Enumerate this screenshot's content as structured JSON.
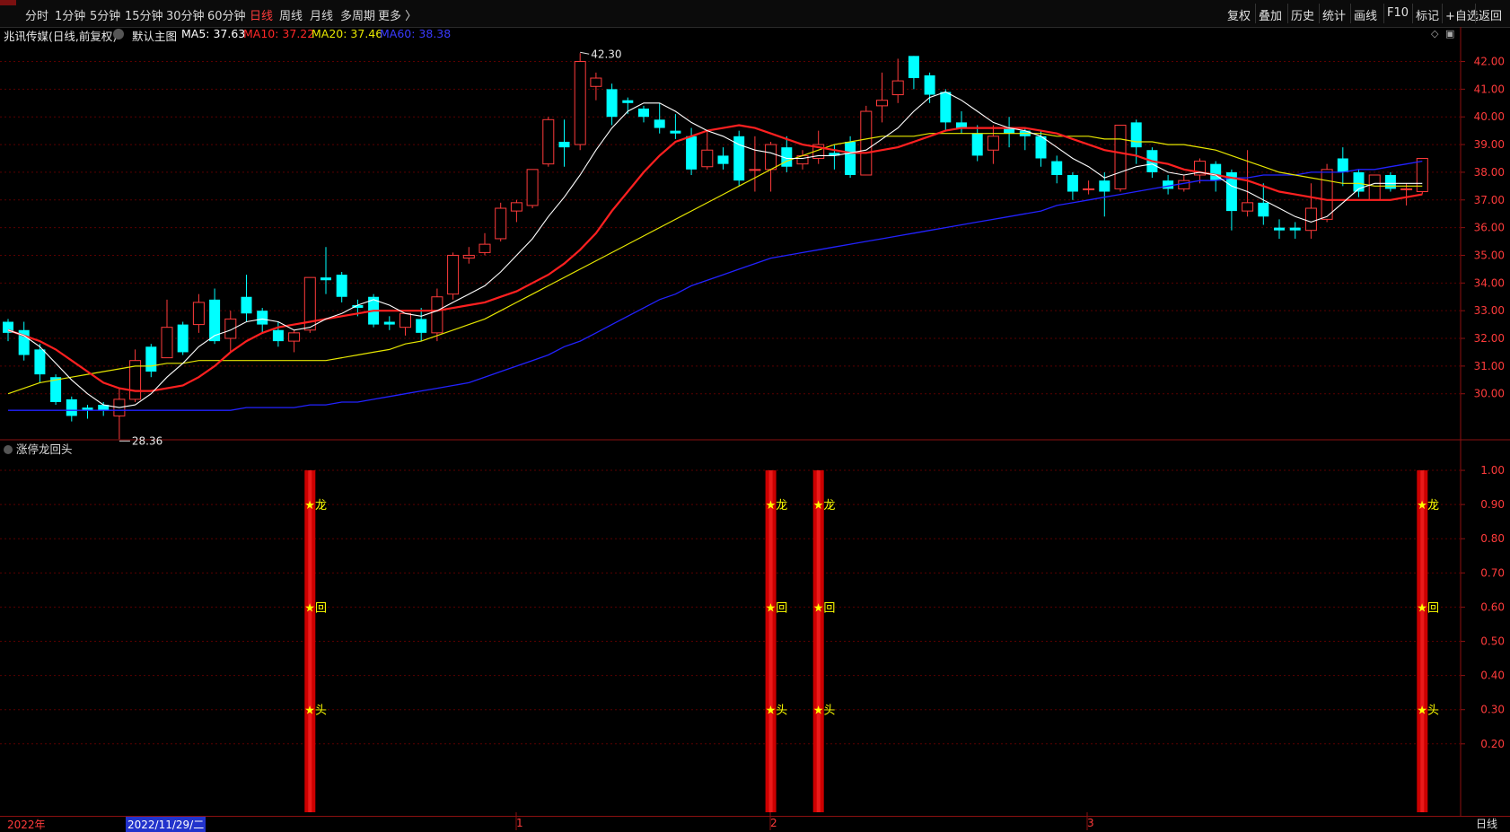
{
  "toolbar": {
    "left_items": [
      {
        "label": "分时",
        "active": false
      },
      {
        "label": "1分钟",
        "active": false
      },
      {
        "label": "5分钟",
        "active": false
      },
      {
        "label": "15分钟",
        "active": false
      },
      {
        "label": "30分钟",
        "active": false
      },
      {
        "label": "60分钟",
        "active": false
      },
      {
        "label": "日线",
        "active": true
      },
      {
        "label": "周线",
        "active": false
      },
      {
        "label": "月线",
        "active": false
      },
      {
        "label": "多周期",
        "active": false
      },
      {
        "label": "更多 〉",
        "active": false
      }
    ],
    "right_items": [
      "复权",
      "叠加",
      "历史",
      "统计",
      "画线",
      "F10",
      "标记",
      "+自选",
      "返回"
    ]
  },
  "info": {
    "stock": "兆讯传媒(日线,前复权)",
    "chart_mode": "默认主图",
    "ma5": "MA5: 37.63",
    "ma10": "MA10: 37.22",
    "ma20": "MA20: 37.46",
    "ma60": "MA60: 38.38"
  },
  "colors": {
    "up": "#ff3b3b",
    "down": "#00ffff",
    "ma5": "#ffffff",
    "ma10": "#ff2020",
    "ma20": "#e6e600",
    "ma60": "#2222ff",
    "grid": "#5a0000",
    "signal_bar": "#cc0000",
    "signal_text": "#ffff00"
  },
  "indicator": {
    "name": "涨停龙回头",
    "signal_labels": [
      "★龙",
      "★回",
      "★头"
    ]
  },
  "bottom": {
    "year": "2022年",
    "cursor_date": "2022/11/29/二",
    "months": [
      "1",
      "2",
      "3"
    ],
    "period_label": "日线"
  },
  "chart_data": [
    {
      "type": "candlestick",
      "title": "兆讯传媒(日线,前复权)",
      "ylim": [
        28.5,
        42.6
      ],
      "yticks": [
        "42.00",
        "41.00",
        "40.00",
        "39.00",
        "38.00",
        "37.00",
        "36.00",
        "35.00",
        "34.00",
        "33.00",
        "32.00",
        "31.00",
        "30.00"
      ],
      "high_annotation": "42.30",
      "low_annotation": "28.36",
      "candles": [
        {
          "o": 32.6,
          "h": 32.7,
          "c": 32.2,
          "l": 31.9
        },
        {
          "o": 32.3,
          "h": 32.6,
          "c": 31.4,
          "l": 31.2
        },
        {
          "o": 31.6,
          "h": 31.8,
          "c": 30.7,
          "l": 30.4
        },
        {
          "o": 30.6,
          "h": 30.7,
          "c": 29.7,
          "l": 29.6
        },
        {
          "o": 29.8,
          "h": 29.9,
          "c": 29.2,
          "l": 29.0
        },
        {
          "o": 29.5,
          "h": 29.6,
          "c": 29.4,
          "l": 29.1
        },
        {
          "o": 29.6,
          "h": 29.7,
          "c": 29.4,
          "l": 29.2
        },
        {
          "o": 29.2,
          "h": 30.2,
          "c": 29.8,
          "l": 28.36
        },
        {
          "o": 29.8,
          "h": 31.6,
          "c": 31.2,
          "l": 29.7
        },
        {
          "o": 31.7,
          "h": 31.8,
          "c": 30.8,
          "l": 30.6
        },
        {
          "o": 31.3,
          "h": 33.4,
          "c": 32.4,
          "l": 31.3
        },
        {
          "o": 32.5,
          "h": 32.6,
          "c": 31.5,
          "l": 31.4
        },
        {
          "o": 32.5,
          "h": 33.6,
          "c": 33.3,
          "l": 32.2
        },
        {
          "o": 33.4,
          "h": 33.8,
          "c": 31.9,
          "l": 31.8
        },
        {
          "o": 32.0,
          "h": 33.0,
          "c": 32.7,
          "l": 31.5
        },
        {
          "o": 33.5,
          "h": 34.3,
          "c": 32.9,
          "l": 32.6
        },
        {
          "o": 33.0,
          "h": 33.1,
          "c": 32.5,
          "l": 32.2
        },
        {
          "o": 32.3,
          "h": 32.6,
          "c": 31.9,
          "l": 31.7
        },
        {
          "o": 31.9,
          "h": 32.3,
          "c": 32.2,
          "l": 31.5
        },
        {
          "o": 32.3,
          "h": 34.2,
          "c": 34.2,
          "l": 32.2
        },
        {
          "o": 34.2,
          "h": 35.3,
          "c": 34.1,
          "l": 33.6
        },
        {
          "o": 34.3,
          "h": 34.4,
          "c": 33.5,
          "l": 33.3
        },
        {
          "o": 33.2,
          "h": 33.4,
          "c": 33.1,
          "l": 32.8
        },
        {
          "o": 33.5,
          "h": 33.6,
          "c": 32.5,
          "l": 32.4
        },
        {
          "o": 32.6,
          "h": 32.8,
          "c": 32.5,
          "l": 32.3
        },
        {
          "o": 32.4,
          "h": 32.9,
          "c": 32.9,
          "l": 32.1
        },
        {
          "o": 32.7,
          "h": 33.1,
          "c": 32.2,
          "l": 31.9
        },
        {
          "o": 32.2,
          "h": 33.8,
          "c": 33.5,
          "l": 31.9
        },
        {
          "o": 33.6,
          "h": 35.1,
          "c": 35.0,
          "l": 33.4
        },
        {
          "o": 34.9,
          "h": 35.3,
          "c": 35.0,
          "l": 34.7
        },
        {
          "o": 35.1,
          "h": 35.8,
          "c": 35.4,
          "l": 35.0
        },
        {
          "o": 35.6,
          "h": 36.9,
          "c": 36.7,
          "l": 35.5
        },
        {
          "o": 36.6,
          "h": 37.0,
          "c": 36.9,
          "l": 36.2
        },
        {
          "o": 36.8,
          "h": 38.1,
          "c": 38.1,
          "l": 36.7
        },
        {
          "o": 38.3,
          "h": 40.0,
          "c": 39.9,
          "l": 38.2
        },
        {
          "o": 39.1,
          "h": 39.9,
          "c": 38.9,
          "l": 38.2
        },
        {
          "o": 39.0,
          "h": 42.3,
          "c": 42.0,
          "l": 38.8
        },
        {
          "o": 41.1,
          "h": 41.6,
          "c": 41.4,
          "l": 40.6
        },
        {
          "o": 41.0,
          "h": 41.2,
          "c": 40.0,
          "l": 39.7
        },
        {
          "o": 40.6,
          "h": 40.7,
          "c": 40.5,
          "l": 40.1
        },
        {
          "o": 40.3,
          "h": 40.4,
          "c": 40.0,
          "l": 39.8
        },
        {
          "o": 39.9,
          "h": 40.5,
          "c": 39.6,
          "l": 39.4
        },
        {
          "o": 39.5,
          "h": 40.1,
          "c": 39.4,
          "l": 39.2
        },
        {
          "o": 39.3,
          "h": 39.6,
          "c": 38.1,
          "l": 37.9
        },
        {
          "o": 38.2,
          "h": 39.5,
          "c": 38.8,
          "l": 38.1
        },
        {
          "o": 38.6,
          "h": 38.9,
          "c": 38.3,
          "l": 38.1
        },
        {
          "o": 39.3,
          "h": 39.5,
          "c": 37.7,
          "l": 37.5
        },
        {
          "o": 38.1,
          "h": 39.3,
          "c": 38.1,
          "l": 37.3
        },
        {
          "o": 38.1,
          "h": 39.1,
          "c": 39.0,
          "l": 37.3
        },
        {
          "o": 38.9,
          "h": 39.3,
          "c": 38.2,
          "l": 38.0
        },
        {
          "o": 38.3,
          "h": 38.8,
          "c": 38.6,
          "l": 38.1
        },
        {
          "o": 38.5,
          "h": 39.5,
          "c": 39.0,
          "l": 38.3
        },
        {
          "o": 38.7,
          "h": 39.0,
          "c": 38.6,
          "l": 38.1
        },
        {
          "o": 39.1,
          "h": 39.3,
          "c": 37.9,
          "l": 37.8
        },
        {
          "o": 37.9,
          "h": 40.4,
          "c": 40.2,
          "l": 37.9
        },
        {
          "o": 40.4,
          "h": 41.6,
          "c": 40.6,
          "l": 39.8
        },
        {
          "o": 40.8,
          "h": 42.1,
          "c": 41.3,
          "l": 40.5
        },
        {
          "o": 42.2,
          "h": 42.2,
          "c": 41.4,
          "l": 41.0
        },
        {
          "o": 41.5,
          "h": 41.6,
          "c": 40.8,
          "l": 40.5
        },
        {
          "o": 40.9,
          "h": 41.0,
          "c": 39.8,
          "l": 39.5
        },
        {
          "o": 39.8,
          "h": 40.2,
          "c": 39.6,
          "l": 39.4
        },
        {
          "o": 39.4,
          "h": 39.7,
          "c": 38.6,
          "l": 38.4
        },
        {
          "o": 38.8,
          "h": 39.7,
          "c": 39.3,
          "l": 38.3
        },
        {
          "o": 39.6,
          "h": 40.0,
          "c": 39.4,
          "l": 38.9
        },
        {
          "o": 39.5,
          "h": 39.6,
          "c": 39.3,
          "l": 38.8
        },
        {
          "o": 39.3,
          "h": 39.5,
          "c": 38.5,
          "l": 38.2
        },
        {
          "o": 38.4,
          "h": 38.6,
          "c": 37.9,
          "l": 37.6
        },
        {
          "o": 37.9,
          "h": 38.0,
          "c": 37.3,
          "l": 37.0
        },
        {
          "o": 37.4,
          "h": 37.7,
          "c": 37.4,
          "l": 37.2
        },
        {
          "o": 37.7,
          "h": 38.0,
          "c": 37.3,
          "l": 36.4
        },
        {
          "o": 37.4,
          "h": 39.7,
          "c": 39.7,
          "l": 37.3
        },
        {
          "o": 39.8,
          "h": 39.9,
          "c": 38.9,
          "l": 38.3
        },
        {
          "o": 38.8,
          "h": 38.9,
          "c": 38.0,
          "l": 37.8
        },
        {
          "o": 37.7,
          "h": 37.9,
          "c": 37.4,
          "l": 37.2
        },
        {
          "o": 37.4,
          "h": 37.9,
          "c": 37.7,
          "l": 37.3
        },
        {
          "o": 37.9,
          "h": 38.5,
          "c": 38.4,
          "l": 37.6
        },
        {
          "o": 38.3,
          "h": 38.4,
          "c": 37.7,
          "l": 37.3
        },
        {
          "o": 38.0,
          "h": 38.1,
          "c": 36.6,
          "l": 35.9
        },
        {
          "o": 36.6,
          "h": 38.8,
          "c": 36.9,
          "l": 36.4
        },
        {
          "o": 36.9,
          "h": 37.6,
          "c": 36.4,
          "l": 36.1
        },
        {
          "o": 36.0,
          "h": 36.3,
          "c": 35.9,
          "l": 35.6
        },
        {
          "o": 36.0,
          "h": 36.2,
          "c": 35.9,
          "l": 35.6
        },
        {
          "o": 35.9,
          "h": 37.6,
          "c": 36.7,
          "l": 35.6
        },
        {
          "o": 36.3,
          "h": 38.3,
          "c": 38.1,
          "l": 36.2
        },
        {
          "o": 38.5,
          "h": 38.9,
          "c": 38.0,
          "l": 37.5
        },
        {
          "o": 38.0,
          "h": 38.1,
          "c": 37.3,
          "l": 37.1
        },
        {
          "o": 37.0,
          "h": 37.4,
          "c": 37.9,
          "l": 37.0
        },
        {
          "o": 37.9,
          "h": 38.0,
          "c": 37.4,
          "l": 37.3
        },
        {
          "o": 37.4,
          "h": 37.6,
          "c": 37.4,
          "l": 36.8
        },
        {
          "o": 37.3,
          "h": 38.5,
          "c": 38.5,
          "l": 37.2
        }
      ],
      "ma5": [
        32.3,
        32.1,
        31.7,
        31.1,
        30.5,
        30.0,
        29.6,
        29.5,
        29.6,
        30.0,
        30.6,
        31.1,
        31.7,
        32.1,
        32.3,
        32.6,
        32.7,
        32.6,
        32.3,
        32.4,
        32.7,
        32.9,
        33.2,
        33.4,
        33.2,
        32.9,
        32.8,
        33.0,
        33.3,
        33.6,
        33.9,
        34.4,
        35.0,
        35.6,
        36.4,
        37.1,
        37.9,
        38.8,
        39.6,
        40.2,
        40.5,
        40.5,
        40.2,
        39.8,
        39.5,
        39.3,
        39.0,
        38.8,
        38.7,
        38.5,
        38.5,
        38.6,
        38.6,
        38.7,
        38.8,
        39.2,
        39.6,
        40.2,
        40.7,
        40.9,
        40.6,
        40.2,
        39.8,
        39.6,
        39.5,
        39.3,
        38.9,
        38.5,
        38.2,
        37.8,
        38.0,
        38.2,
        38.3,
        38.0,
        37.9,
        38.0,
        37.9,
        37.5,
        37.3,
        37.0,
        36.7,
        36.4,
        36.2,
        36.4,
        36.9,
        37.4,
        37.6,
        37.6,
        37.6,
        37.6
      ],
      "ma10": [
        32.3,
        32.1,
        31.9,
        31.6,
        31.2,
        30.8,
        30.4,
        30.2,
        30.1,
        30.1,
        30.2,
        30.3,
        30.6,
        31.0,
        31.5,
        31.9,
        32.2,
        32.4,
        32.5,
        32.6,
        32.7,
        32.8,
        32.9,
        33.0,
        33.0,
        33.0,
        33.0,
        33.0,
        33.1,
        33.2,
        33.3,
        33.5,
        33.7,
        34.0,
        34.3,
        34.7,
        35.2,
        35.8,
        36.6,
        37.3,
        38.0,
        38.6,
        39.1,
        39.3,
        39.5,
        39.6,
        39.7,
        39.6,
        39.4,
        39.2,
        39.0,
        38.9,
        38.8,
        38.7,
        38.7,
        38.8,
        38.9,
        39.1,
        39.3,
        39.5,
        39.6,
        39.6,
        39.6,
        39.6,
        39.6,
        39.5,
        39.4,
        39.2,
        39.0,
        38.8,
        38.7,
        38.6,
        38.4,
        38.3,
        38.1,
        38.0,
        37.9,
        37.8,
        37.7,
        37.5,
        37.3,
        37.2,
        37.1,
        37.0,
        37.0,
        37.0,
        37.0,
        37.0,
        37.1,
        37.2
      ],
      "ma20": [
        30.0,
        30.2,
        30.4,
        30.5,
        30.6,
        30.7,
        30.8,
        30.9,
        31.0,
        31.0,
        31.1,
        31.1,
        31.2,
        31.2,
        31.2,
        31.2,
        31.2,
        31.2,
        31.2,
        31.2,
        31.2,
        31.3,
        31.4,
        31.5,
        31.6,
        31.8,
        31.9,
        32.1,
        32.3,
        32.5,
        32.7,
        33.0,
        33.3,
        33.6,
        33.9,
        34.2,
        34.5,
        34.8,
        35.1,
        35.4,
        35.7,
        36.0,
        36.3,
        36.6,
        36.9,
        37.2,
        37.5,
        37.8,
        38.1,
        38.4,
        38.6,
        38.8,
        39.0,
        39.1,
        39.2,
        39.3,
        39.3,
        39.3,
        39.4,
        39.4,
        39.4,
        39.4,
        39.4,
        39.4,
        39.4,
        39.4,
        39.3,
        39.3,
        39.3,
        39.2,
        39.2,
        39.1,
        39.1,
        39.0,
        39.0,
        38.9,
        38.8,
        38.6,
        38.4,
        38.2,
        38.0,
        37.9,
        37.8,
        37.7,
        37.6,
        37.6,
        37.5,
        37.5,
        37.5,
        37.5
      ],
      "ma60": [
        29.4,
        29.4,
        29.4,
        29.4,
        29.4,
        29.4,
        29.4,
        29.4,
        29.4,
        29.4,
        29.4,
        29.4,
        29.4,
        29.4,
        29.4,
        29.5,
        29.5,
        29.5,
        29.5,
        29.6,
        29.6,
        29.7,
        29.7,
        29.8,
        29.9,
        30.0,
        30.1,
        30.2,
        30.3,
        30.4,
        30.6,
        30.8,
        31.0,
        31.2,
        31.4,
        31.7,
        31.9,
        32.2,
        32.5,
        32.8,
        33.1,
        33.4,
        33.6,
        33.9,
        34.1,
        34.3,
        34.5,
        34.7,
        34.9,
        35.0,
        35.1,
        35.2,
        35.3,
        35.4,
        35.5,
        35.6,
        35.7,
        35.8,
        35.9,
        36.0,
        36.1,
        36.2,
        36.3,
        36.4,
        36.5,
        36.6,
        36.8,
        36.9,
        37.0,
        37.1,
        37.2,
        37.3,
        37.4,
        37.5,
        37.6,
        37.7,
        37.7,
        37.8,
        37.8,
        37.9,
        37.9,
        37.9,
        38.0,
        38.0,
        38.0,
        38.1,
        38.1,
        38.2,
        38.3,
        38.4
      ]
    },
    {
      "type": "bar",
      "title": "涨停龙回头",
      "ylim": [
        0.0,
        1.05
      ],
      "yticks": [
        "1.00",
        "0.90",
        "0.80",
        "0.70",
        "0.60",
        "0.50",
        "0.40",
        "0.30",
        "0.20"
      ],
      "signal_indices": [
        19,
        48,
        51,
        89
      ],
      "signal_value": 1.0
    }
  ]
}
